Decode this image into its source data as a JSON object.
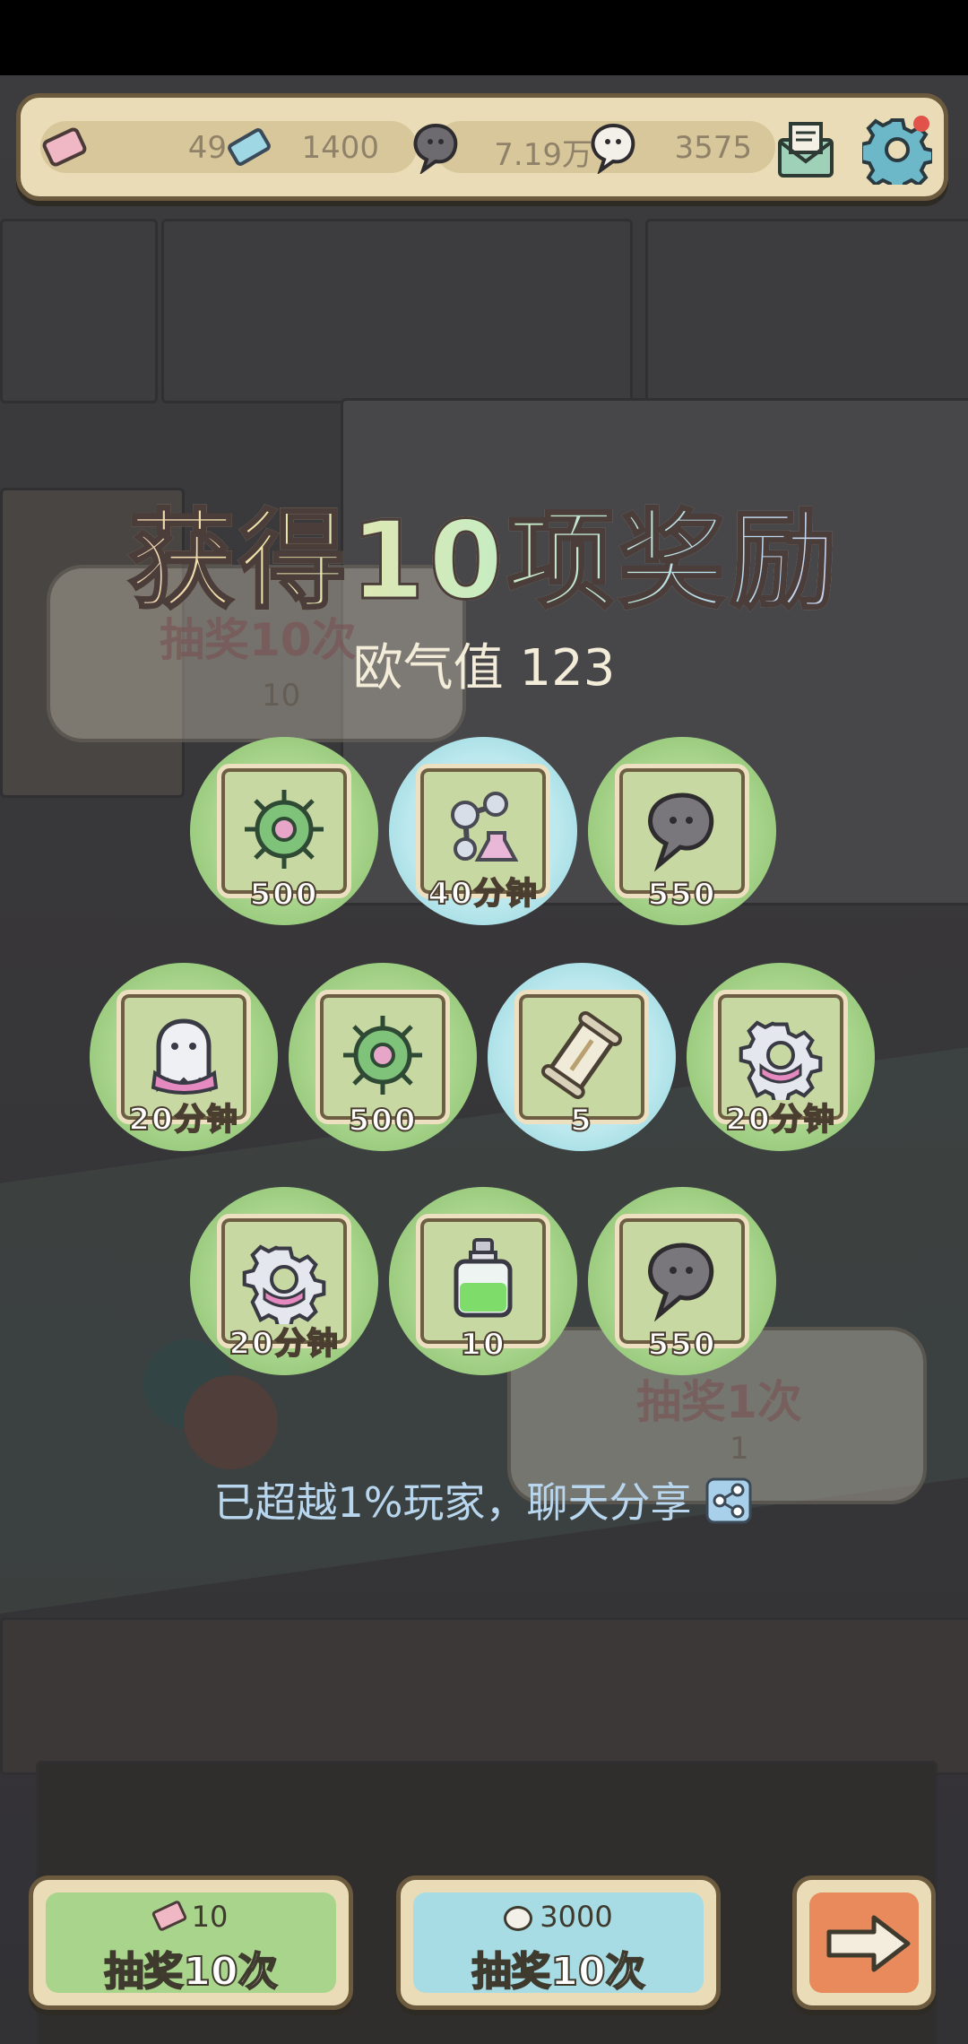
{
  "resources": {
    "tickets": "49",
    "gems": "1400",
    "dark_souls": "7.19万",
    "light_souls": "3575"
  },
  "title": "获得10项奖励",
  "luck_label": "欧气值 123",
  "rewards": [
    {
      "icon": "virus-cell-icon",
      "qty": "500"
    },
    {
      "icon": "molecule-flask-icon",
      "qty": "40分钟"
    },
    {
      "icon": "dark-soul-icon",
      "qty": "550"
    },
    {
      "icon": "ghost-icon",
      "qty": "20分钟"
    },
    {
      "icon": "virus-cell-icon",
      "qty": "500"
    },
    {
      "icon": "scroll-icon",
      "qty": "5"
    },
    {
      "icon": "gear-icon",
      "qty": "20分钟"
    },
    {
      "icon": "gear-icon",
      "qty": "20分钟"
    },
    {
      "icon": "potion-bottle-icon",
      "qty": "10"
    },
    {
      "icon": "dark-soul-icon",
      "qty": "550"
    }
  ],
  "share_text": "已超越1%玩家，聊天分享",
  "background_buttons": {
    "draw10_label": "抽奖10次",
    "draw10_cost": "10",
    "draw1_label": "抽奖1次",
    "draw1_cost": "1"
  },
  "bottom": {
    "ticket_draw": {
      "cost": "10",
      "label": "抽奖10次"
    },
    "soul_draw": {
      "cost": "3000",
      "label": "抽奖10次"
    }
  },
  "colors": {
    "green_item": "#a8d48c",
    "blue_item": "#bde9ee",
    "bar_bg": "#e9dcb6",
    "border": "#6b5a3e"
  }
}
